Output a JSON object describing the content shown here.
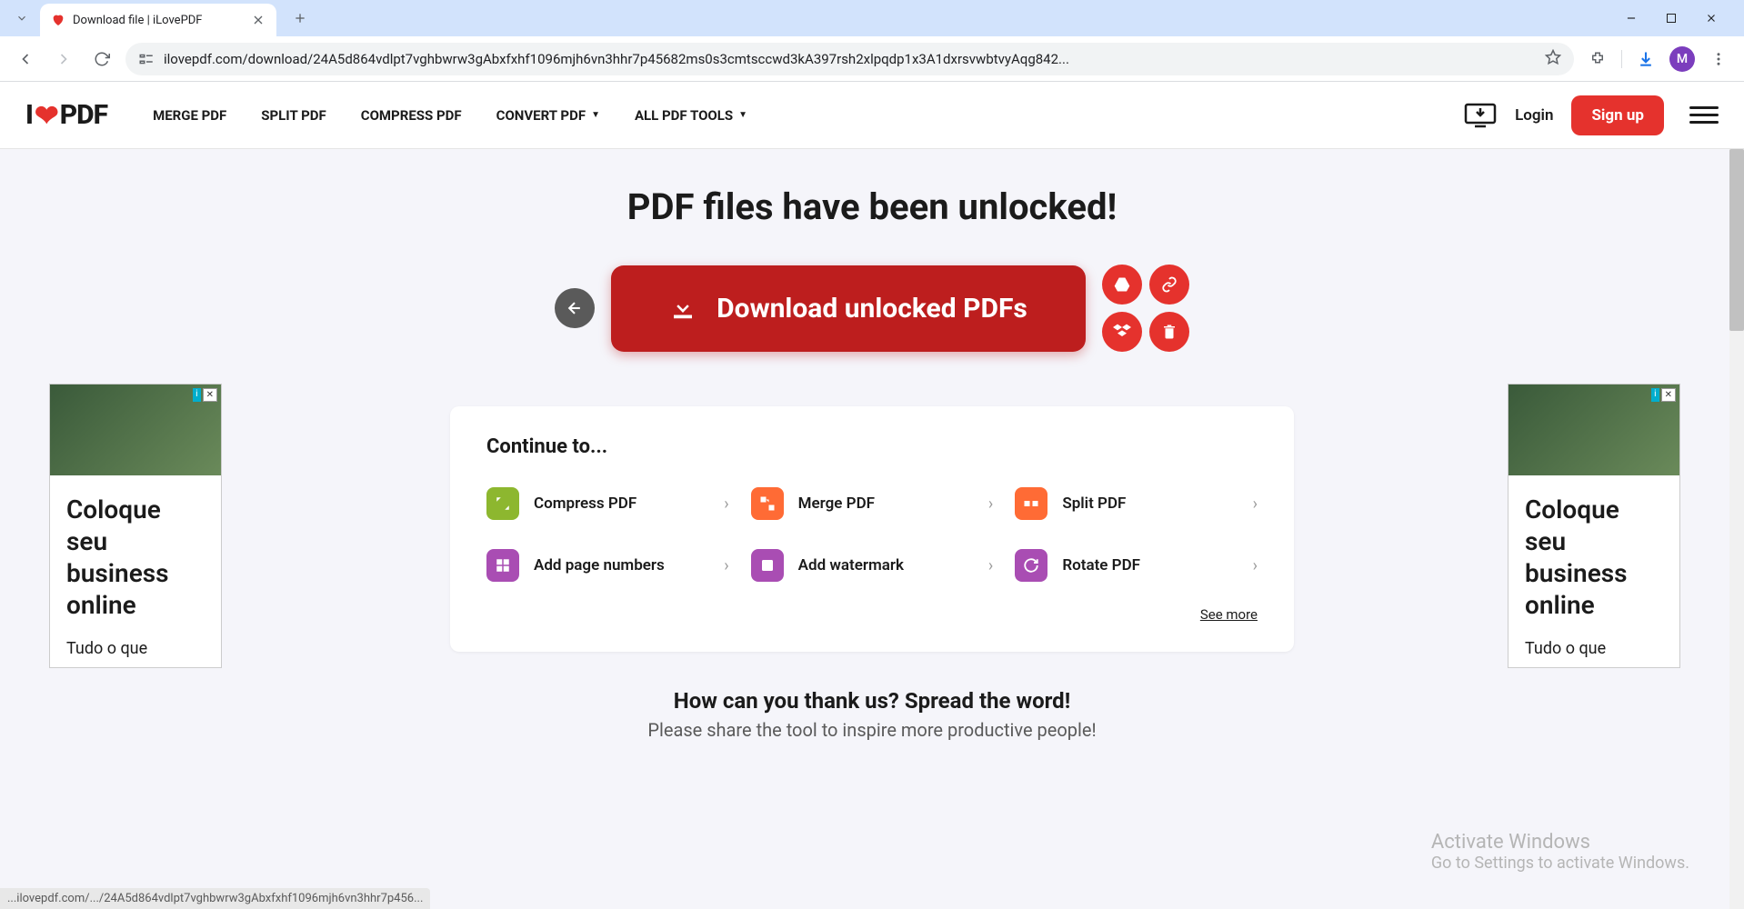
{
  "browser": {
    "tab_title": "Download file | iLovePDF",
    "url": "ilovepdf.com/download/24A5d864vdlpt7vghbwrw3gAbxfxhf1096mjh6vn3hhr7p45682ms0s3cmtsccwd3kA397rsh2xlpqdp1x3A1dxrsvwbtvyAqg842...",
    "profile_initial": "M"
  },
  "header": {
    "logo_prefix": "I",
    "logo_suffix": "PDF",
    "nav": [
      "MERGE PDF",
      "SPLIT PDF",
      "COMPRESS PDF",
      "CONVERT PDF",
      "ALL PDF TOOLS"
    ],
    "login": "Login",
    "signup": "Sign up"
  },
  "main": {
    "title": "PDF files have been unlocked!",
    "download_label": "Download unlocked PDFs"
  },
  "continue": {
    "title": "Continue to...",
    "items": [
      {
        "label": "Compress PDF",
        "color": "green"
      },
      {
        "label": "Merge PDF",
        "color": "orange"
      },
      {
        "label": "Split PDF",
        "color": "orange"
      },
      {
        "label": "Add page numbers",
        "color": "purple"
      },
      {
        "label": "Add watermark",
        "color": "purple"
      },
      {
        "label": "Rotate PDF",
        "color": "purple"
      }
    ],
    "see_more": "See more"
  },
  "thank": {
    "title": "How can you thank us? Spread the word!",
    "subtitle": "Please share the tool to inspire more productive people!"
  },
  "ads": {
    "headline": "Coloque seu business online",
    "sub": "Tudo o que"
  },
  "watermark": {
    "line1": "Activate Windows",
    "line2": "Go to Settings to activate Windows."
  },
  "status_url": "...ilovepdf.com/.../24A5d864vdlpt7vghbwrw3gAbxfxhf1096mjh6vn3hhr7p456..."
}
